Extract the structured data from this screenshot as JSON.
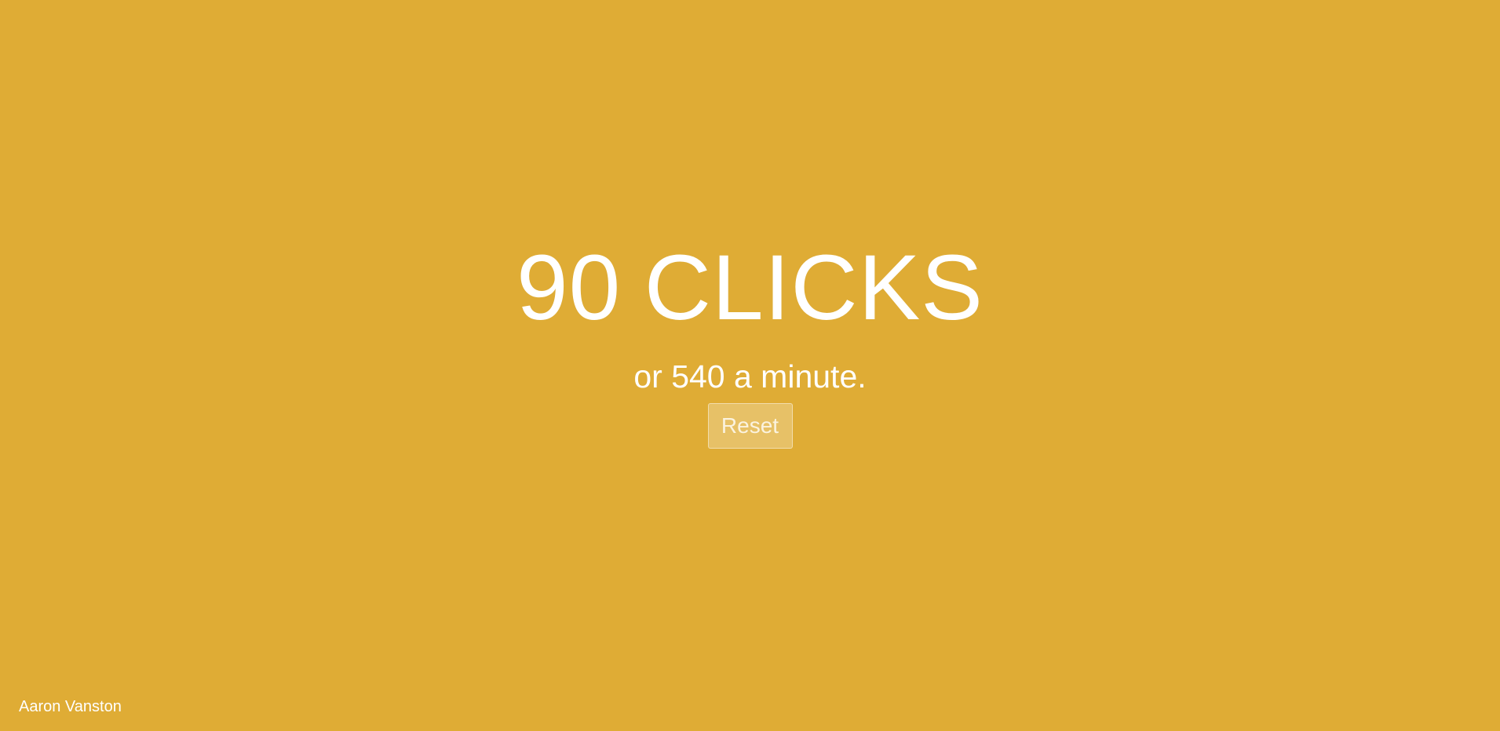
{
  "theme": {
    "background": "#dfac35",
    "text": "#ffffff"
  },
  "counter": {
    "count": "90",
    "label": "CLICKS"
  },
  "rate": {
    "text": "or 540 a minute."
  },
  "reset": {
    "label": "Reset"
  },
  "footer": {
    "author": "Aaron Vanston"
  }
}
